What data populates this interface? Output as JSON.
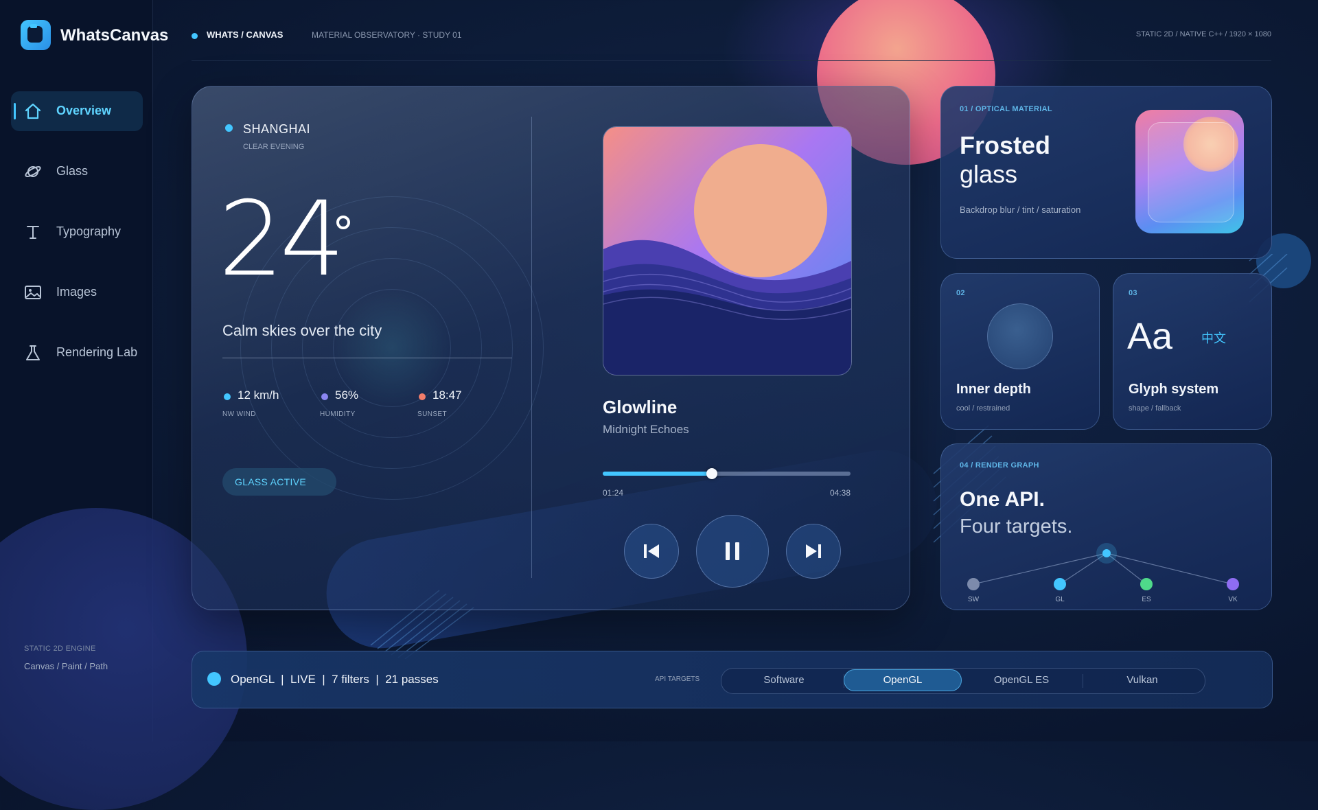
{
  "brand": {
    "name": "WhatsCanvas"
  },
  "sidebar": {
    "items": [
      {
        "label": "Overview",
        "icon": "home-icon",
        "active": true
      },
      {
        "label": "Glass",
        "icon": "planet-icon",
        "active": false
      },
      {
        "label": "Typography",
        "icon": "text-icon",
        "active": false
      },
      {
        "label": "Images",
        "icon": "image-icon",
        "active": false
      },
      {
        "label": "Rendering Lab",
        "icon": "flask-icon",
        "active": false
      }
    ],
    "engine_title": "STATIC 2D ENGINE",
    "engine_sub": "Canvas / Paint / Path"
  },
  "header": {
    "title": "WHATS / CANVAS",
    "subtitle": "MATERIAL OBSERVATORY · STUDY 01",
    "right": "STATIC 2D  /  NATIVE C++  /  1920 × 1080"
  },
  "weather": {
    "city": "SHANGHAI",
    "condition": "CLEAR EVENING",
    "temperature": "24",
    "tagline": "Calm skies over the city",
    "stats": [
      {
        "value": "12 km/h",
        "label": "NW WIND",
        "color": "#43c6ff"
      },
      {
        "value": "56%",
        "label": "HUMIDITY",
        "color": "#8b86f2"
      },
      {
        "value": "18:47",
        "label": "SUNSET",
        "color": "#f27d6a"
      }
    ],
    "pill": "GLASS ACTIVE"
  },
  "player": {
    "song": "Glowline",
    "artist": "Midnight Echoes",
    "current_time": "01:24",
    "total_time": "04:38",
    "progress": 0.44,
    "controls": {
      "prev": "previous-icon",
      "play": "pause-icon",
      "next": "next-icon"
    }
  },
  "cards": {
    "optical": {
      "tag": "01 / OPTICAL MATERIAL",
      "title_line1": "Frosted",
      "title_line2": "glass",
      "sub": "Backdrop blur / tint / saturation"
    },
    "inner": {
      "tag": "02",
      "title": "Inner depth",
      "sub": "cool / restrained"
    },
    "glyph": {
      "tag": "03",
      "sample": "Aa",
      "cjk": "中文",
      "title": "Glyph system",
      "sub": "shape / fallback"
    },
    "render": {
      "tag": "04 / RENDER GRAPH",
      "title": "One API.",
      "subtitle": "Four targets.",
      "nodes": [
        {
          "label": "SW",
          "color": "#7d8bac"
        },
        {
          "label": "GL",
          "color": "#43c6ff"
        },
        {
          "label": "ES",
          "color": "#4fd98a"
        },
        {
          "label": "VK",
          "color": "#8f6df2"
        }
      ]
    }
  },
  "bottom": {
    "status": "OpenGL  |  LIVE  |  7 filters  |  21 passes",
    "api_label": "API TARGETS",
    "targets": [
      "Software",
      "OpenGL",
      "OpenGL ES",
      "Vulkan"
    ],
    "selected": "OpenGL"
  },
  "colors": {
    "accent": "#43c6ff",
    "background": "#0c1a35",
    "sun": "#f0ad8e"
  }
}
